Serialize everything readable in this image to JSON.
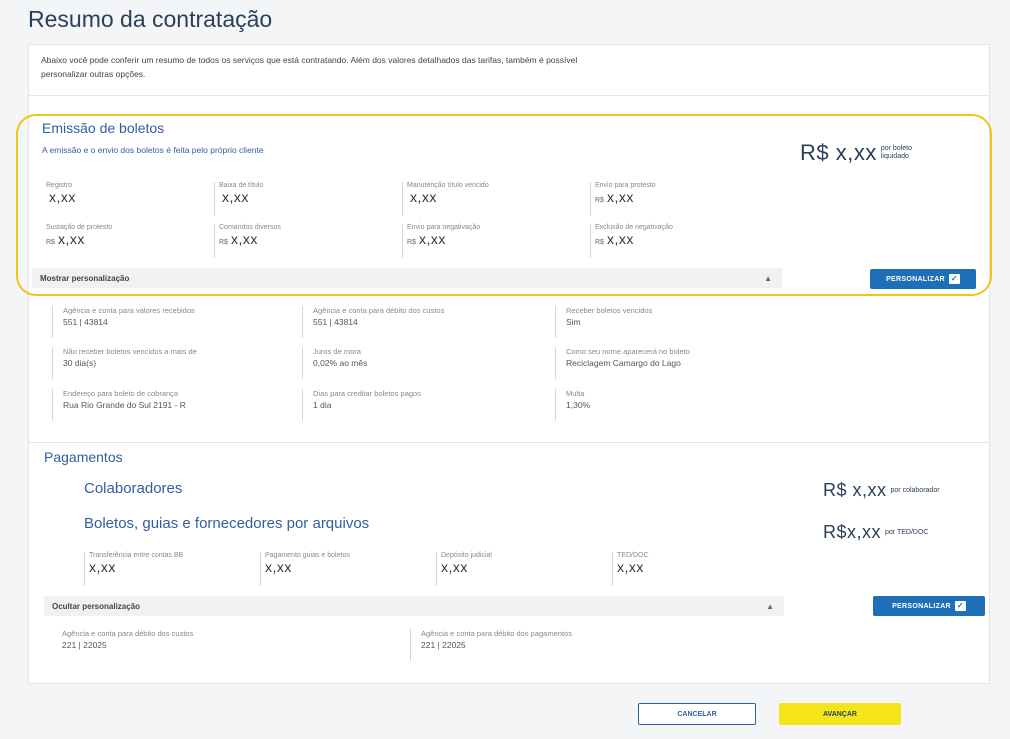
{
  "page": {
    "title": "Resumo da contratação"
  },
  "intro": "Abaixo você pode conferir um resumo de todos os serviços que está contratando. Além dos valores detalhados das tarifas, também é possível personalizar outras opções.",
  "boletos": {
    "title": "Emissão de boletos",
    "subtitle": "A emissão e o envio dos boletos é feita pelo próprio cliente",
    "price": "R$ x,xx",
    "price_unit": "por boleto liquidado",
    "fees": [
      {
        "label": "Registro",
        "currency": "",
        "value": "x,xx"
      },
      {
        "label": "Baixa de título",
        "currency": "",
        "value": "x,xx"
      },
      {
        "label": "Manutenção título vencido",
        "currency": "",
        "value": "x,xx"
      },
      {
        "label": "Envio para protesto",
        "currency": "R$",
        "value": "x,xx"
      },
      {
        "label": "Sustação de protesto",
        "currency": "R$",
        "value": "x,xx"
      },
      {
        "label": "Comandos diversos",
        "currency": "R$",
        "value": "x,xx"
      },
      {
        "label": "Envio para negativação",
        "currency": "R$",
        "value": "x,xx"
      },
      {
        "label": "Exclusão de negativação",
        "currency": "R$",
        "value": "x,xx"
      }
    ],
    "toggle_label": "Mostrar personalização",
    "personalize_label": "PERSONALIZAR",
    "details": [
      {
        "label": "Agência e conta para valores recebidos",
        "value": "551 | 43814"
      },
      {
        "label": "Agência e conta para débito dos custos",
        "value": "551 | 43814"
      },
      {
        "label": "Receber boletos vencidos",
        "value": "Sim"
      },
      {
        "label": "Não receber boletos vencidos a mais de",
        "value": "30 dia(s)"
      },
      {
        "label": "Juros de mora",
        "value": "0,02% ao mês"
      },
      {
        "label": "Como seu nome aparecerá no boleto",
        "value": "Reciclagem Camargo do Lago"
      },
      {
        "label": "Endereço para boleto de cobrança",
        "value": "Rua Rio Grande do Sul 2191 - R"
      },
      {
        "label": "Dias para creditar boletos pagos",
        "value": "1 dia"
      },
      {
        "label": "Multa",
        "value": "1,30%"
      }
    ]
  },
  "pagamentos": {
    "title": "Pagamentos",
    "colaboradores": {
      "title": "Colaboradores",
      "price": "R$ x,xx",
      "unit": "por colaborador"
    },
    "arquivos": {
      "title": "Boletos, guias e fornecedores por arquivos",
      "price": "R$x,xx",
      "unit": "por TED/DOC"
    },
    "fees": [
      {
        "label": "Transferência entre contas BB",
        "value": "x,xx"
      },
      {
        "label": "Pagamento guias e boletos",
        "value": "x,xx"
      },
      {
        "label": "Depósito judicial",
        "value": "x,xx"
      },
      {
        "label": "TED/DOC",
        "value": "x,xx"
      }
    ],
    "toggle_label": "Ocultar personalização",
    "personalize_label": "PERSONALIZAR",
    "details": [
      {
        "label": "Agência e conta para débito dos custos",
        "value": "221 | 22025"
      },
      {
        "label": "Agência e conta para débito dos pagamentos",
        "value": "221 | 22025"
      }
    ]
  },
  "actions": {
    "cancel": "CANCELAR",
    "next": "AVANÇAR"
  },
  "colors": {
    "accent": "#2f5fa0",
    "primary_button": "#1f6fb8",
    "highlight": "#f0c419",
    "next_button": "#f5e51a"
  },
  "icons": {
    "personalize": "clipboard-check-icon",
    "toggle": "chevron-up-icon"
  }
}
